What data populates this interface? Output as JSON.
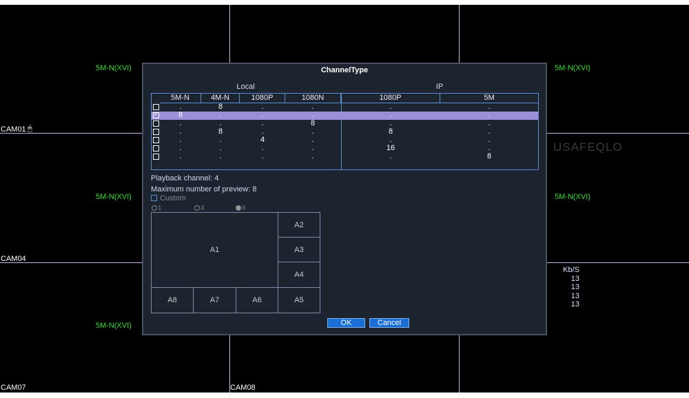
{
  "cams": {
    "cam01": "CAM01",
    "cam04": "CAM04",
    "cam07": "CAM07",
    "cam08": "CAM08"
  },
  "res_labels": {
    "r1": "5M-N(XVI)",
    "r2": "5M-N(XVI)",
    "r3": "5M-N(XVI)",
    "r4": "5M-N(XVI)",
    "r5": "5M-N(XVI)"
  },
  "watermark": "USAFEQLO",
  "kbs": {
    "header": "Kb/S",
    "values": [
      "13",
      "13",
      "13",
      "13"
    ]
  },
  "dialog": {
    "title": "ChannelType",
    "group_local": "Local",
    "group_ip": "IP",
    "columns": [
      "5M-N",
      "4M-N",
      "1080P",
      "1080N",
      "1080P",
      "5M"
    ],
    "rows": [
      {
        "checked": false,
        "selected": false,
        "cells": [
          ".",
          "8",
          ".",
          ".",
          ".",
          "."
        ]
      },
      {
        "checked": true,
        "selected": true,
        "cells": [
          "8",
          ".",
          ".",
          ".",
          ".",
          "."
        ]
      },
      {
        "checked": false,
        "selected": false,
        "cells": [
          ".",
          ".",
          ".",
          "8",
          ".",
          "."
        ]
      },
      {
        "checked": false,
        "selected": false,
        "cells": [
          ".",
          "8",
          ".",
          ".",
          "8",
          "."
        ]
      },
      {
        "checked": false,
        "selected": false,
        "cells": [
          ".",
          ".",
          "4",
          ".",
          ".",
          "."
        ]
      },
      {
        "checked": false,
        "selected": false,
        "cells": [
          ".",
          ".",
          ".",
          ".",
          "16",
          "."
        ]
      },
      {
        "checked": false,
        "selected": false,
        "cells": [
          ".",
          ".",
          ".",
          ".",
          ".",
          "8"
        ]
      }
    ],
    "playback": "Playback channel: 4",
    "max_preview": "Maximum number of preview: 8",
    "custom_label": "Custom",
    "radios": [
      "1",
      "4",
      "8"
    ],
    "radio_selected": "8",
    "panes": [
      "A1",
      "A2",
      "A3",
      "A4",
      "A5",
      "A6",
      "A7",
      "A8"
    ],
    "ok": "OK",
    "cancel": "Cancel"
  }
}
